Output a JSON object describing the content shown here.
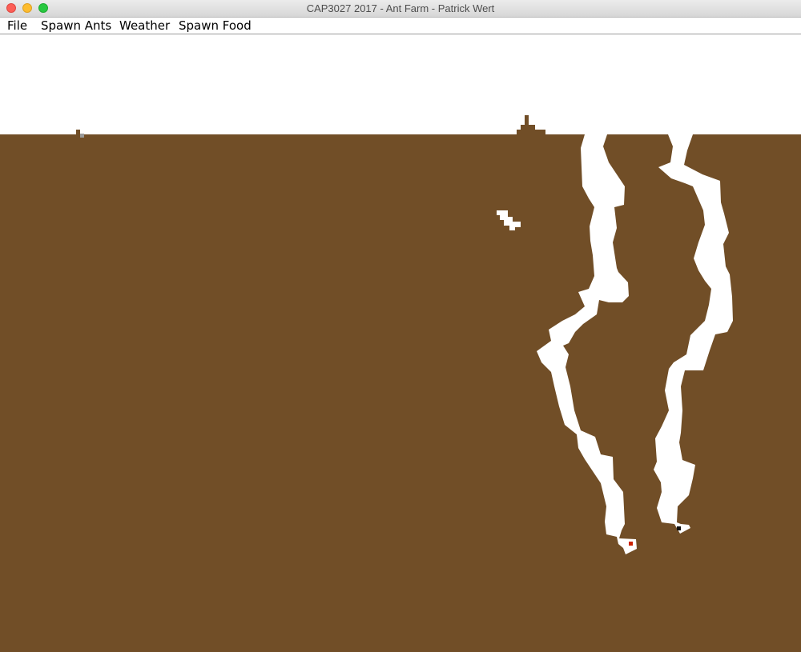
{
  "window": {
    "title": "CAP3027 2017 - Ant Farm - Patrick Wert"
  },
  "menubar": {
    "file_label": "File",
    "spawn_ants_label": "Spawn Ants",
    "weather_label": "Weather",
    "spawn_food_label": "Spawn Food"
  },
  "colors": {
    "sky": "#ffffff",
    "dirt": "#714e27",
    "tunnel": "#ffffff",
    "ant_red": "#cc2200",
    "ant_black": "#111111",
    "food_grey": "#9a9a9a"
  }
}
